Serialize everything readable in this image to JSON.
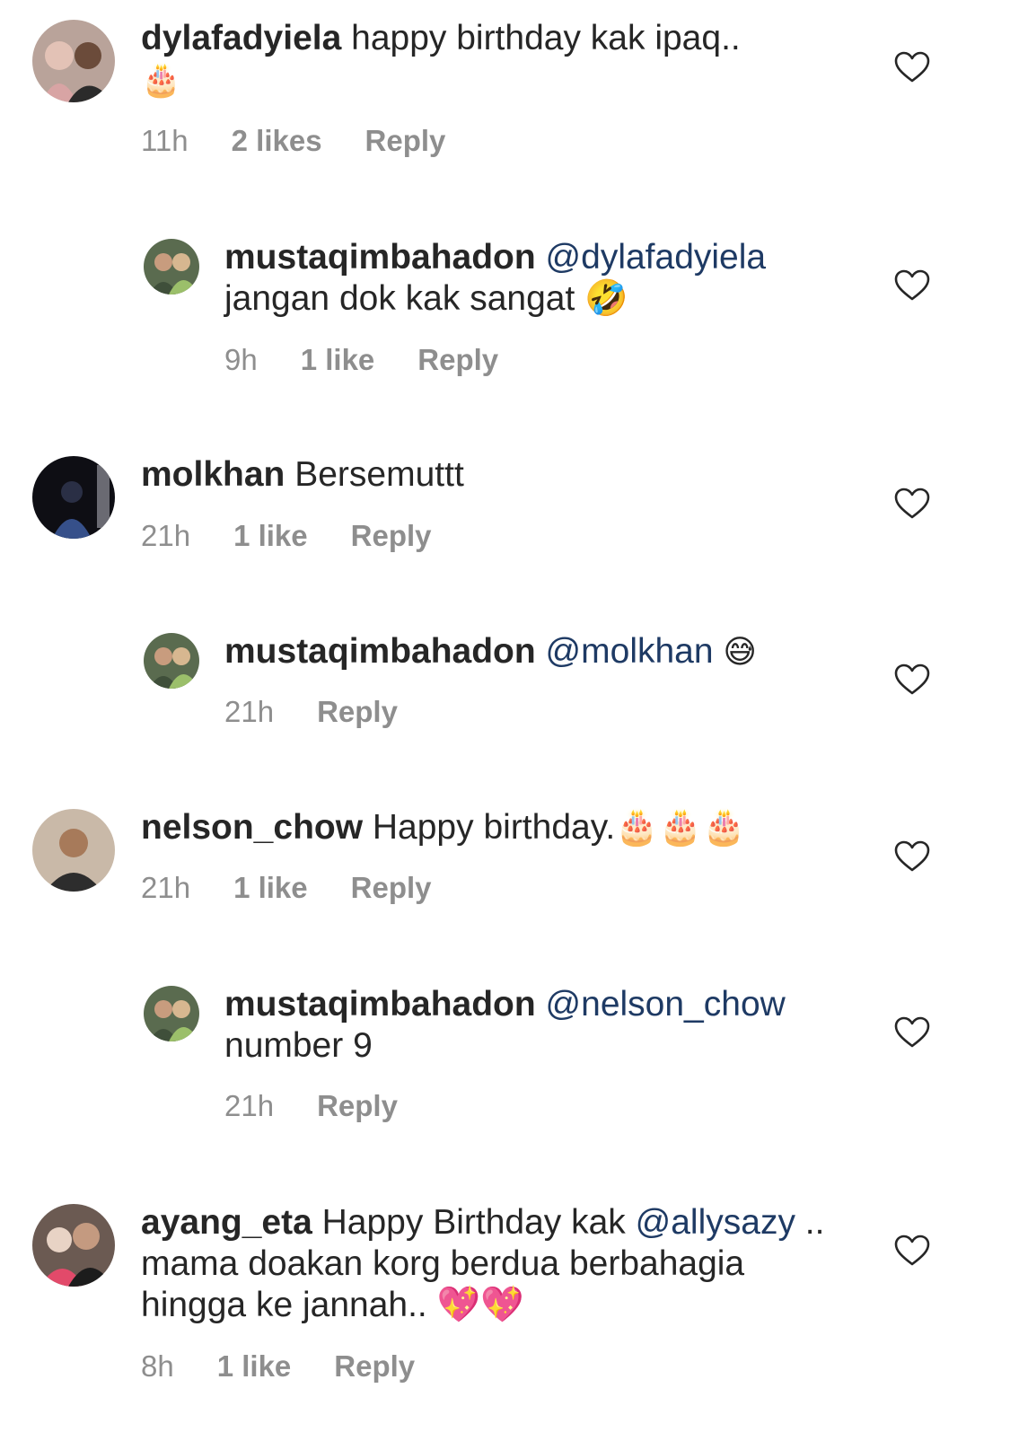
{
  "comments": [
    {
      "username": "dylafadyiela",
      "text": "happy birthday kak ipaq..",
      "text2": "🎂",
      "time": "11h",
      "likes": "2 likes",
      "reply": "Reply",
      "icon": "heart-outline-icon"
    },
    {
      "username": "mustaqimbahadon",
      "mention": "@dylafadyiela",
      "text": "jangan dok kak sangat 🤣",
      "time": "9h",
      "likes": "1 like",
      "reply": "Reply",
      "icon": "heart-outline-icon"
    },
    {
      "username": "molkhan",
      "text": "Bersemuttt",
      "time": "21h",
      "likes": "1 like",
      "reply": "Reply",
      "icon": "heart-outline-icon"
    },
    {
      "username": "mustaqimbahadon",
      "mention": "@molkhan",
      "text": "😅",
      "time": "21h",
      "reply": "Reply",
      "icon": "heart-outline-icon"
    },
    {
      "username": "nelson_chow",
      "text": "Happy birthday.🎂🎂🎂",
      "time": "21h",
      "likes": "1 like",
      "reply": "Reply",
      "icon": "heart-outline-icon"
    },
    {
      "username": "mustaqimbahadon",
      "mention": "@nelson_chow",
      "text": "number 9",
      "time": "21h",
      "reply": "Reply",
      "icon": "heart-outline-icon"
    },
    {
      "username": "ayang_eta",
      "text": "Happy Birthday kak",
      "mention": "@allysazy",
      "text2": ".. mama doakan korg berdua berbahagia hingga ke jannah.. 💖💖",
      "time": "8h",
      "likes": "1 like",
      "reply": "Reply",
      "icon": "heart-outline-icon"
    }
  ],
  "colors": {
    "text": "#262626",
    "meta": "#8e8e8e",
    "mention": "#1e3a64"
  }
}
